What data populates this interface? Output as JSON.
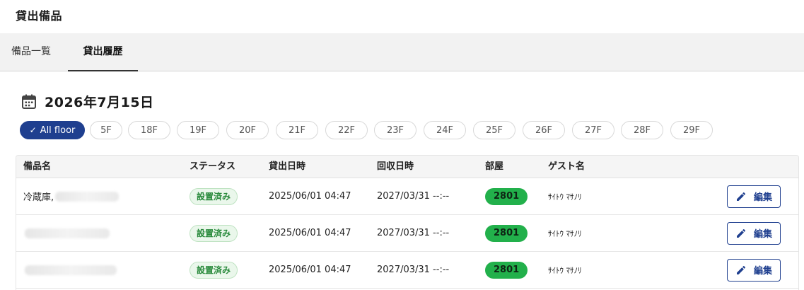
{
  "page": {
    "title": "貸出備品"
  },
  "tabs": [
    {
      "label": "備品一覧",
      "active": false
    },
    {
      "label": "貸出履歴",
      "active": true
    }
  ],
  "date": {
    "label": "2026年7月15日",
    "icon": "calendar-icon"
  },
  "floors": {
    "all_label": "All floor",
    "items": [
      "5F",
      "18F",
      "19F",
      "20F",
      "21F",
      "22F",
      "23F",
      "24F",
      "25F",
      "26F",
      "27F",
      "28F",
      "29F"
    ]
  },
  "table": {
    "headers": [
      "備品名",
      "ステータス",
      "貸出日時",
      "回収日時",
      "部屋",
      "ゲスト名"
    ],
    "rows": [
      {
        "name": "冷蔵庫,",
        "status": "設置済み",
        "lent_at": "2025/06/01 04:47",
        "returned_at": "2027/03/31 --:--",
        "room": "2801",
        "guest": "ｻｲﾄｳ ﾏｻﾉﾘ",
        "edit_label": "編集"
      },
      {
        "name": "",
        "status": "設置済み",
        "lent_at": "2025/06/01 04:47",
        "returned_at": "2027/03/31 --:--",
        "room": "2801",
        "guest": "ｻｲﾄｳ ﾏｻﾉﾘ",
        "edit_label": "編集"
      },
      {
        "name": "",
        "status": "設置済み",
        "lent_at": "2025/06/01 04:47",
        "returned_at": "2027/03/31 --:--",
        "room": "2801",
        "guest": "ｻｲﾄｳ ﾏｻﾉﾘ",
        "edit_label": "編集"
      }
    ]
  },
  "colors": {
    "primary": "#1f3f8f",
    "status_green": "#27893a",
    "room_green": "#22b04b"
  }
}
